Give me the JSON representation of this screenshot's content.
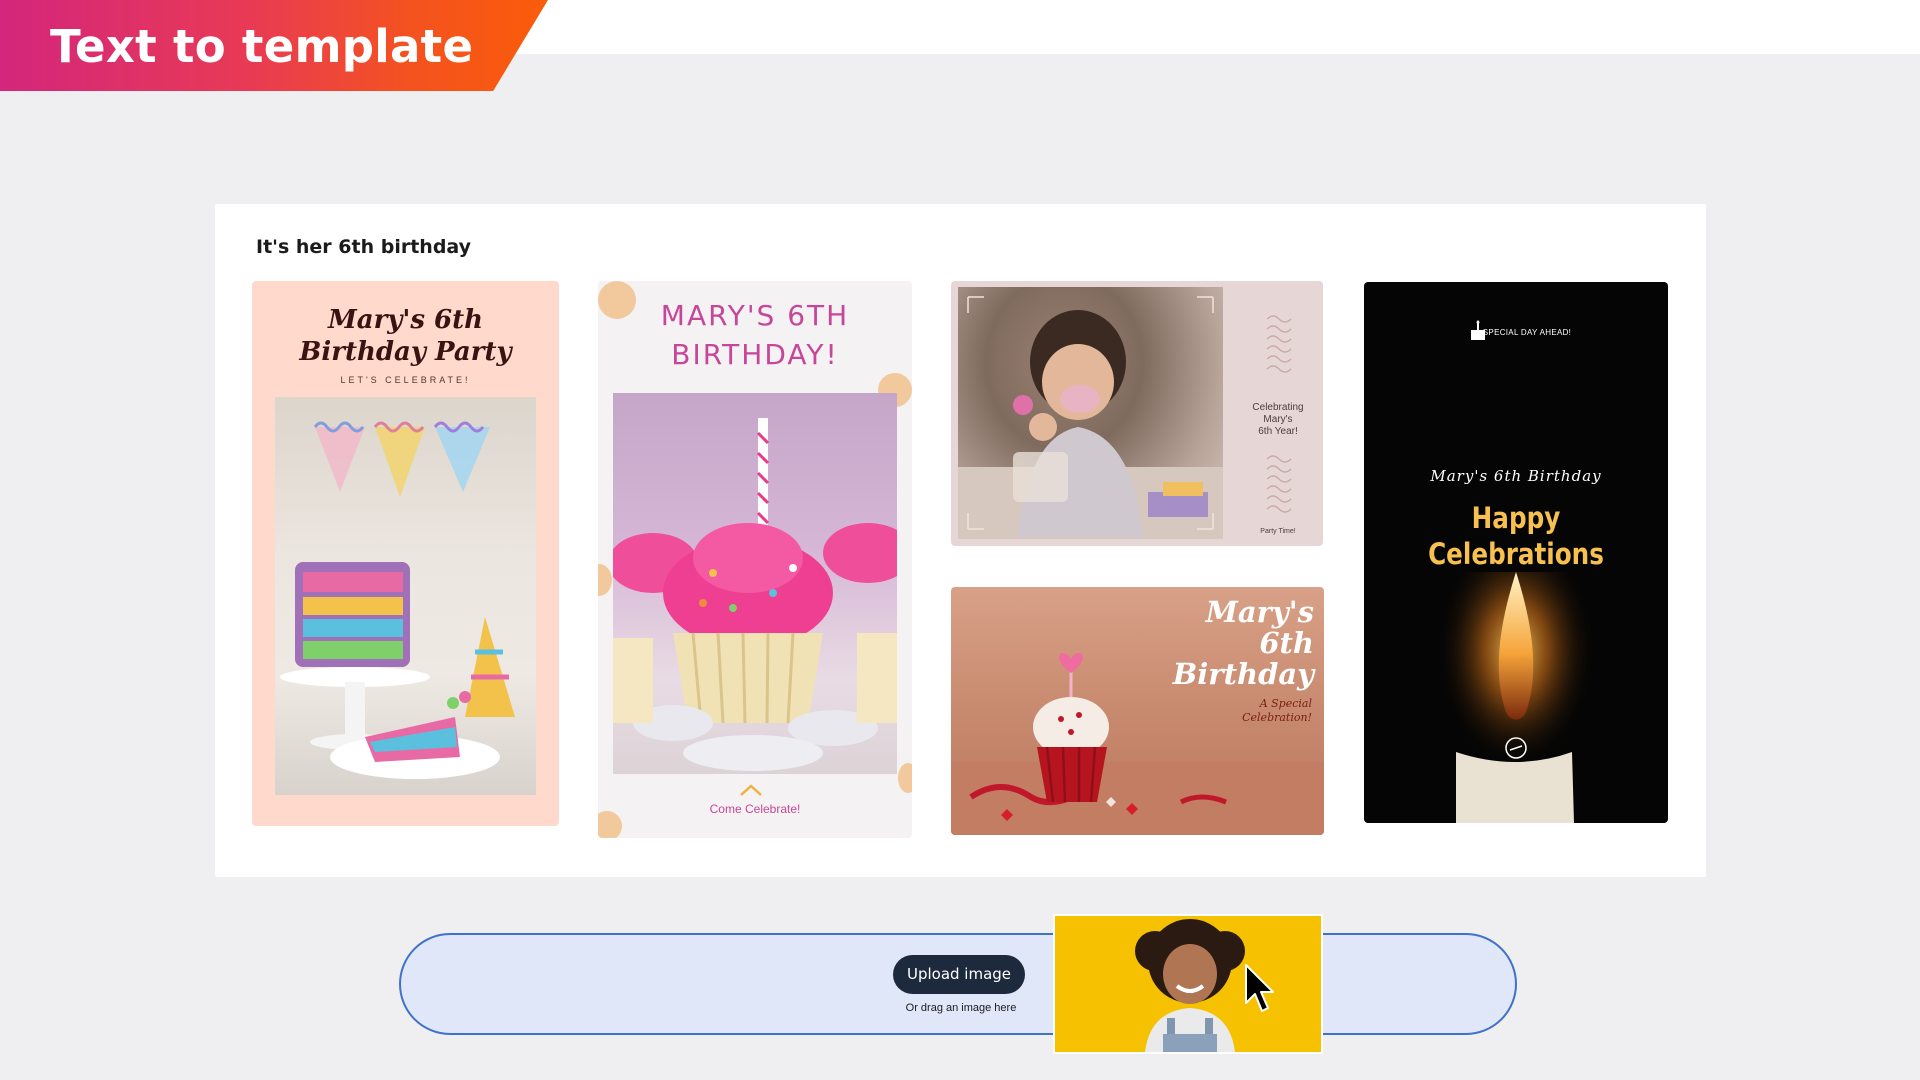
{
  "banner": {
    "title": "Text to template"
  },
  "prompt": {
    "text": "It's her 6th birthday"
  },
  "templates": [
    {
      "title_line1": "Mary's 6th",
      "title_line2": "Birthday Party",
      "subtitle": "LET'S CELEBRATE!"
    },
    {
      "title_line1": "MARY'S 6TH",
      "title_line2": "BIRTHDAY!",
      "footer": "Come Celebrate!"
    },
    {
      "side_text_line1": "Celebrating",
      "side_text_line2": "Mary's",
      "side_text_line3": "6th Year!",
      "footer": "Party Time!"
    },
    {
      "title_line1": "Mary's",
      "title_line2": "6th",
      "title_line3": "Birthday",
      "subtitle_line1": "A Special",
      "subtitle_line2": "Celebration!"
    },
    {
      "top": "SPECIAL DAY AHEAD!",
      "script": "Mary's 6th Birthday",
      "headline_line1": "Happy",
      "headline_line2": "Celebrations"
    }
  ],
  "upload": {
    "button_label": "Upload image",
    "hint": "Or drag an image here"
  },
  "colors": {
    "banner_start": "#d4267c",
    "banner_end": "#fa5c0a",
    "accent_pink": "#c64799",
    "accent_gold": "#f7c04f",
    "upload_border": "#3f72c8"
  }
}
